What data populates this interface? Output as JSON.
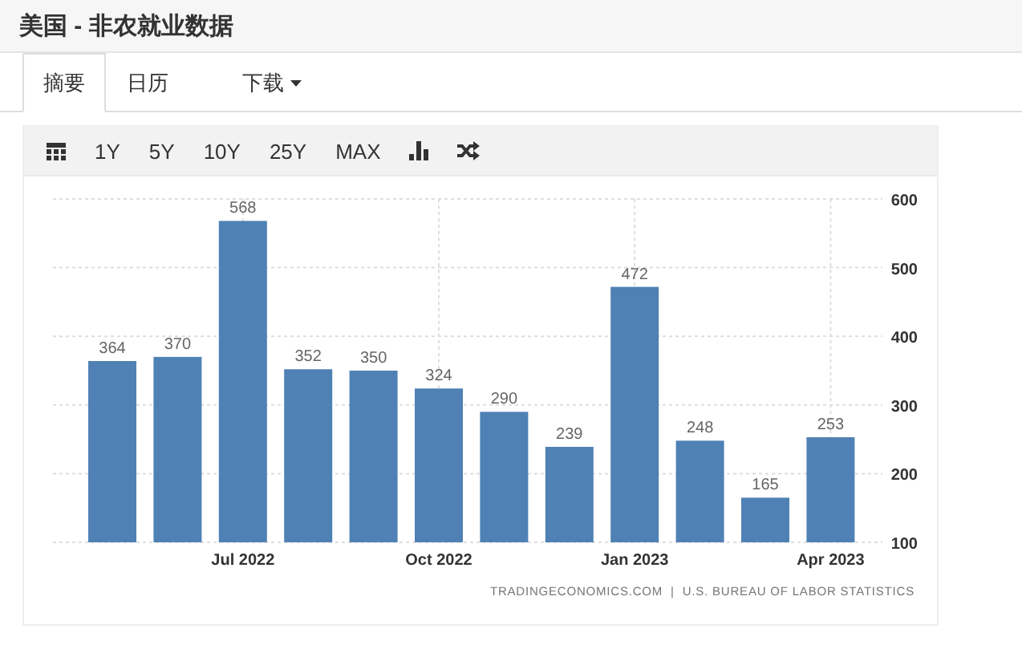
{
  "header": {
    "title": "美国 - 非农就业数据"
  },
  "tabs": [
    {
      "label": "摘要",
      "selected": true
    },
    {
      "label": "日历",
      "selected": false
    },
    {
      "label": "下载",
      "selected": false,
      "kind": "dropdown"
    }
  ],
  "toolbar": [
    {
      "kind": "calendar"
    },
    {
      "kind": "text",
      "label": "1Y"
    },
    {
      "kind": "text",
      "label": "5Y"
    },
    {
      "kind": "text",
      "label": "10Y"
    },
    {
      "kind": "text",
      "label": "25Y"
    },
    {
      "kind": "text",
      "label": "MAX"
    },
    {
      "kind": "barchart"
    },
    {
      "kind": "shuffle"
    }
  ],
  "chart": {
    "chart_data": {
      "type": "bar",
      "values": [
        364,
        370,
        568,
        352,
        350,
        324,
        290,
        239,
        472,
        248,
        165,
        253
      ],
      "categories": [
        null,
        null,
        "Jul 2022",
        null,
        null,
        "Oct 2022",
        null,
        null,
        "Jan 2023",
        null,
        null,
        "Apr 2023"
      ],
      "ylim": [
        100,
        600
      ],
      "yticks": [
        100,
        200,
        300,
        400,
        500,
        600
      ],
      "data_labels": true,
      "grid": true
    }
  },
  "source": "TRADINGECONOMICS.COM  |  U.S. BUREAU OF LABOR STATISTICS"
}
